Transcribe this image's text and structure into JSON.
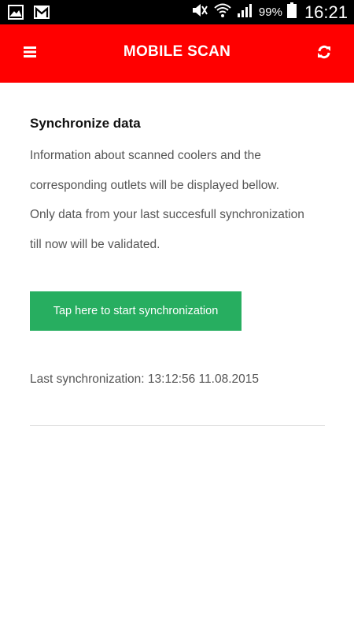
{
  "status_bar": {
    "battery": "99%",
    "time": "16:21",
    "icons": [
      "image-icon",
      "gmail-icon",
      "mute-icon",
      "wifi-icon",
      "signal-icon",
      "battery-icon"
    ]
  },
  "app_bar": {
    "title": "MOBILE SCAN",
    "menu_icon": "menu-icon",
    "refresh_icon": "refresh-icon",
    "background_color": "#ff0000"
  },
  "content": {
    "section_title": "Synchronize data",
    "paragraph_lines": [
      "Information about scanned coolers and the",
      "corresponding outlets will be displayed bellow.",
      "Only data from your last succesfull synchronization",
      "till now will be validated."
    ],
    "sync_button_label": "Tap here to start synchronization",
    "sync_button_color": "#27ae60",
    "last_sync": "Last synchronization: 13:12:56 11.08.2015"
  }
}
